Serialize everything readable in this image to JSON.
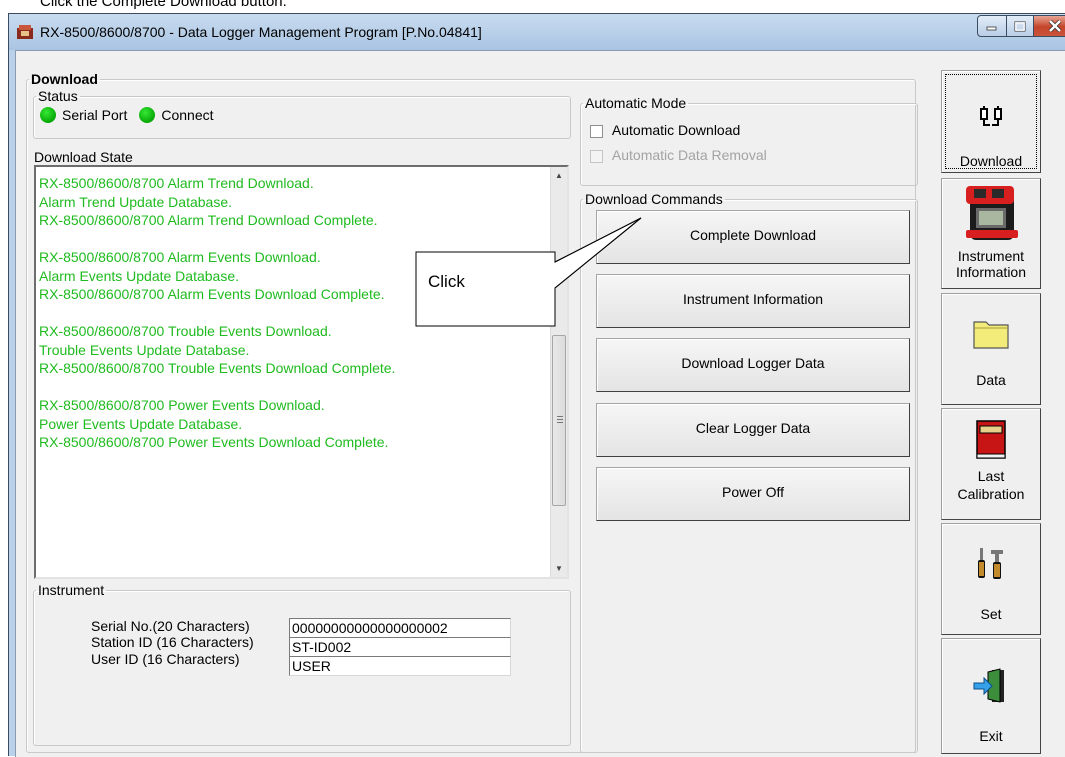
{
  "caption": "Click the Complete Download button.",
  "window": {
    "title": "RX-8500/8600/8700 - Data Logger Management Program [P.No.04841]",
    "controls": [
      "minimize-icon",
      "maximize-icon",
      "close-icon"
    ]
  },
  "download_group": {
    "legend": "Download"
  },
  "status": {
    "legend": "Status",
    "indicators": [
      {
        "label": "Serial Port",
        "color": "#0ab50a"
      },
      {
        "label": "Connect",
        "color": "#0ab50a"
      }
    ]
  },
  "download_state": {
    "label": "Download State",
    "log_color": "#1fbb1f",
    "lines": [
      "RX-8500/8600/8700 Alarm Trend Download.",
      "Alarm Trend Update Database.",
      "RX-8500/8600/8700 Alarm Trend Download Complete.",
      "",
      "RX-8500/8600/8700 Alarm Events Download.",
      "Alarm Events Update Database.",
      "RX-8500/8600/8700 Alarm Events Download Complete.",
      "",
      "RX-8500/8600/8700 Trouble Events Download.",
      "Trouble Events Update Database.",
      "RX-8500/8600/8700 Trouble Events Download Complete.",
      "",
      "RX-8500/8600/8700 Power Events Download.",
      "Power Events Update Database.",
      "RX-8500/8600/8700 Power Events Download Complete."
    ]
  },
  "instrument": {
    "legend": "Instrument",
    "fields": [
      {
        "label": "Serial No.(20 Characters)",
        "value": "00000000000000000002"
      },
      {
        "label": "Station ID (16 Characters)",
        "value": "ST-ID002"
      },
      {
        "label": "User ID (16 Characters)",
        "value": "USER"
      }
    ]
  },
  "automatic_mode": {
    "legend": "Automatic Mode",
    "options": [
      {
        "label": "Automatic Download",
        "checked": false,
        "enabled": true
      },
      {
        "label": "Automatic Data Removal",
        "checked": false,
        "enabled": false
      }
    ]
  },
  "download_commands": {
    "legend": "Download Commands",
    "buttons": [
      "Complete Download",
      "Instrument Information",
      "Download Logger Data",
      "Clear Logger Data",
      "Power Off"
    ]
  },
  "sidebar": {
    "items": [
      {
        "label": "Download",
        "icon": "download-cable-icon",
        "active": true
      },
      {
        "label": "Instrument\nInformation",
        "icon": "gas-detector-icon"
      },
      {
        "label": "Data",
        "icon": "folder-icon"
      },
      {
        "label": "Last\nCalibration",
        "icon": "red-book-icon"
      },
      {
        "label": "Set",
        "icon": "tools-icon"
      },
      {
        "label": "Exit",
        "icon": "exit-door-icon"
      }
    ]
  },
  "callout": {
    "text": "Click"
  }
}
